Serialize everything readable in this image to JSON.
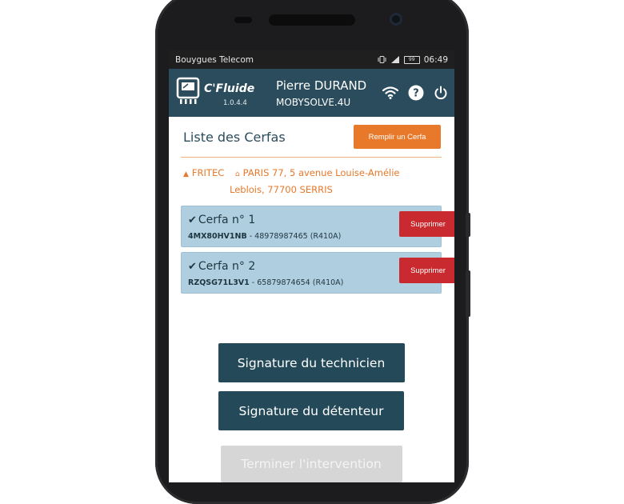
{
  "status_bar": {
    "carrier": "Bouygues Telecom",
    "battery": "99",
    "time": "06:49"
  },
  "app_bar": {
    "app_name": "C'Fluide",
    "version": "1.0.4.4",
    "user_name": "Pierre DURAND",
    "company": "MOBYSOLVE.4U",
    "icons": [
      "wifi-icon",
      "help-icon",
      "power-icon"
    ]
  },
  "list": {
    "title": "Liste des Cerfas",
    "fill_button": "Remplir un Cerfa"
  },
  "client": {
    "name": "FRITEC",
    "address_line1": "PARIS 77, 5 avenue Louise-Amélie",
    "address_line2": "Leblois, 77700 SERRIS"
  },
  "cerfas": [
    {
      "title": "Cerfa n° 1",
      "serial": "4MX80HV1NB",
      "detail": " - 48978987465 (R410A)",
      "delete_label": "Supprimer"
    },
    {
      "title": "Cerfa n° 2",
      "serial": "RZQSG71L3V1",
      "detail": " - 65879874654 (R410A)",
      "delete_label": "Supprimer"
    }
  ],
  "actions": {
    "technician_signature": "Signature du technicien",
    "holder_signature": "Signature du détenteur",
    "finish": "Terminer l'intervention"
  },
  "colors": {
    "header": "#2a4c5c",
    "accent": "#e8792b",
    "danger": "#c92a2f",
    "card": "#afcfe0",
    "disabled": "#d6d6d6"
  }
}
